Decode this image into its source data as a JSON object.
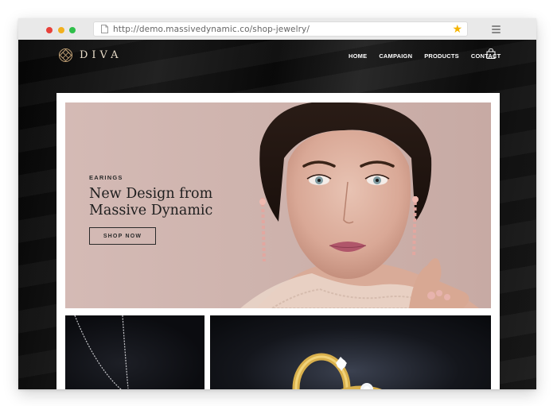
{
  "browser": {
    "url": "http://demo.massivedynamic.co/shop-jewelry/",
    "bookmark_icon": "star-icon",
    "menu_icon": "hamburger-menu-icon"
  },
  "site": {
    "logo_text": "DIVA",
    "nav": [
      "HOME",
      "CAMPAIGN",
      "PRODUCTS",
      "CONTACT"
    ],
    "cart_icon": "shopping-bag-icon"
  },
  "hero": {
    "eyebrow": "EARINGS",
    "title": "New Design from Massive Dynamic",
    "button": "SHOP NOW"
  },
  "colors": {
    "hero_bg": "#cdb2ad",
    "logo_gold": "#e8dcc8",
    "bookmark_star": "#f5b400"
  }
}
